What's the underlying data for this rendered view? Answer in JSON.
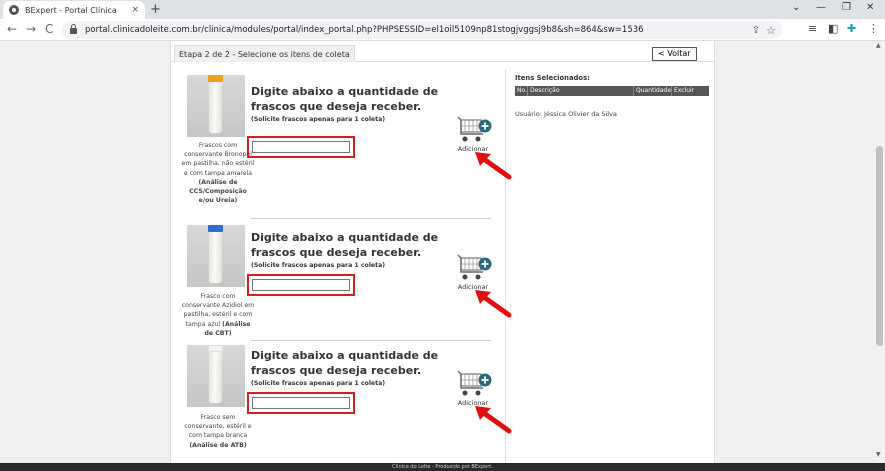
{
  "browser": {
    "tab_title": "BExpert - Portal Clínica",
    "tab_close": "×",
    "new_tab": "+",
    "url": "portal.clinicadoleite.com.br/clinica/modules/portal/index_portal.php?PHPSESSID=el1oil5109np81stogjvggsj9b8&sh=864&sw=1536",
    "back": "←",
    "forward": "→",
    "reload": "C",
    "minimize": "—",
    "maximize": "❐",
    "close": "✕",
    "collapse": "⌄"
  },
  "page": {
    "step_label": "Etapa 2 de 2 - Selecione os itens de coleta",
    "back_button": "< Voltar",
    "heading": "Digite abaixo a quantidade de frascos que deseja receber.",
    "note": "(Solicite frascos apenas para 1 coleta)",
    "add_label": "Adicionar",
    "items": [
      {
        "caption_text": "Frascos com conservante Bronopol em pastilha, não estéril e com tampa amarela",
        "caption_bold": "(Análise de CCS/Composição e/ou Ureia)",
        "cap_color": "#f0a020",
        "qty_value": ""
      },
      {
        "caption_text": "Frasco com conservante Azidiol em pastilha, estéril e com tampa azul",
        "caption_bold": "(Análise de CBT)",
        "cap_color": "#2f6fcf",
        "qty_value": ""
      },
      {
        "caption_text": "Frasco sem conservante, estéril e com tampa branca",
        "caption_bold": "(Análise de ATB)",
        "cap_color": "#f4f4ee",
        "qty_value": ""
      }
    ]
  },
  "selected": {
    "title": "Itens Selecionados:",
    "columns": [
      "No.",
      "Descrição",
      "Quantidade",
      "Excluir"
    ],
    "user": "Usuário: Jéssica Olivier da Silva"
  },
  "footer": {
    "text": "Clínica do Leite - Produzido por BExpert."
  }
}
